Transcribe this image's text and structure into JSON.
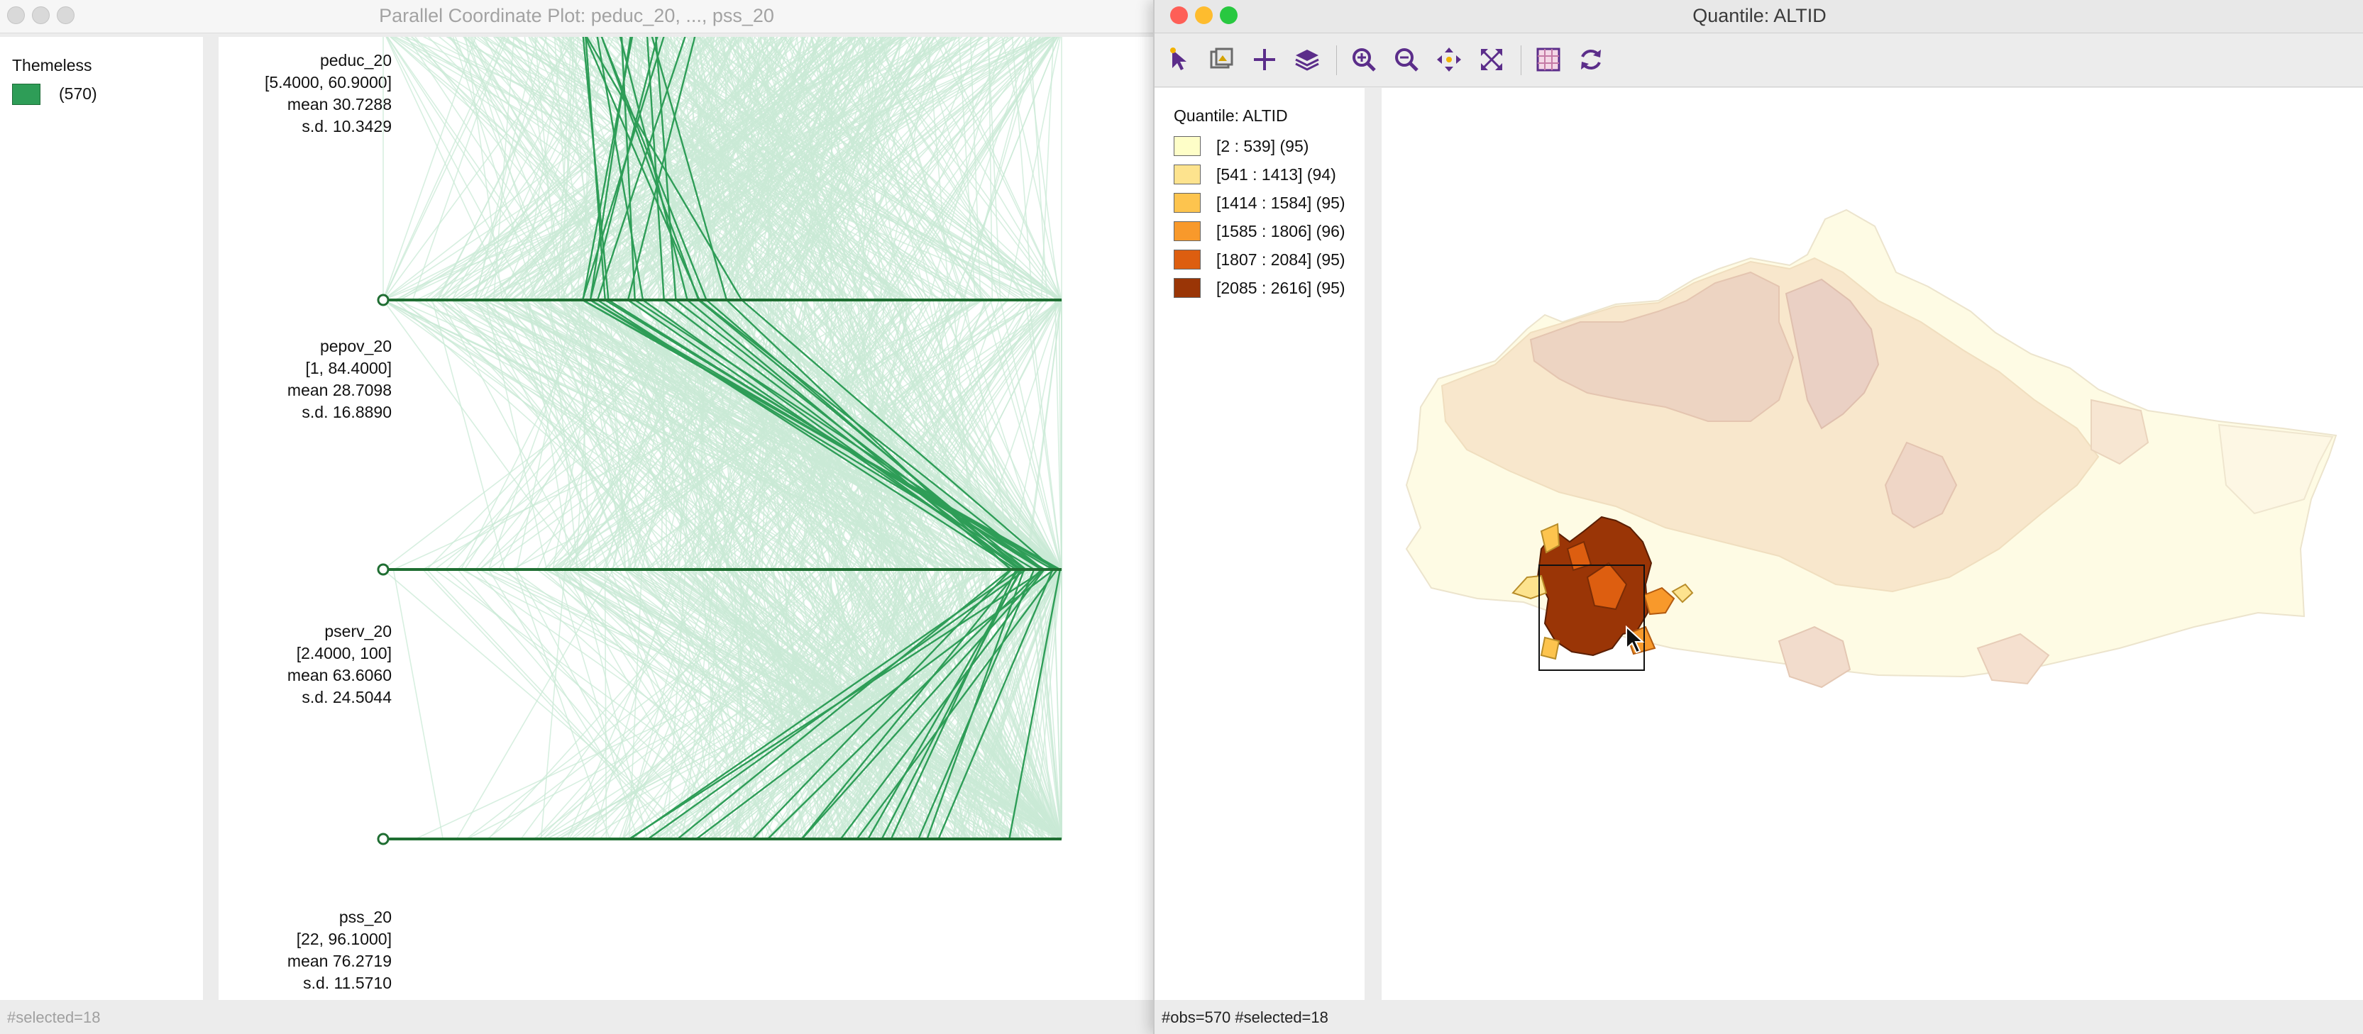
{
  "left_window": {
    "title": "Parallel Coordinate Plot: peduc_20, ..., pss_20",
    "legend": {
      "title": "Themeless",
      "items": [
        {
          "color": "#2e9d57",
          "label": "(570)"
        }
      ]
    },
    "axes": [
      {
        "name": "peduc_20",
        "range": "[5.4000, 60.9000]",
        "mean": "mean  30.7288",
        "sd": "s.d.  10.3429"
      },
      {
        "name": "pepov_20",
        "range": "[1, 84.4000]",
        "mean": "mean  28.7098",
        "sd": "s.d.  16.8890"
      },
      {
        "name": "pserv_20",
        "range": "[2.4000, 100]",
        "mean": "mean  63.6060",
        "sd": "s.d.  24.5044"
      },
      {
        "name": "pss_20",
        "range": "[22, 96.1000]",
        "mean": "mean  76.2719",
        "sd": "s.d.  11.5710"
      }
    ],
    "status": "#selected=18",
    "colors": {
      "line_faint": "#c9e9d6",
      "line_selected": "#2e9d57",
      "axis": "#1f6e32"
    }
  },
  "right_window": {
    "title": "Quantile: ALTID",
    "toolbar": [
      {
        "icon": "select-arrow-icon"
      },
      {
        "icon": "copy-map-icon"
      },
      {
        "icon": "crosshair-icon"
      },
      {
        "icon": "layers-icon"
      },
      {
        "icon": "zoom-in-icon"
      },
      {
        "icon": "zoom-out-icon"
      },
      {
        "icon": "pan-icon"
      },
      {
        "icon": "full-extent-icon"
      },
      {
        "icon": "basemap-icon"
      },
      {
        "icon": "refresh-icon"
      }
    ],
    "legend": {
      "title": "Quantile: ALTID",
      "items": [
        {
          "color": "#fefec8",
          "label": "[2 : 539] (95)"
        },
        {
          "color": "#fde38e",
          "label": "[541 : 1413] (94)"
        },
        {
          "color": "#fdc44e",
          "label": "[1414 : 1584] (95)"
        },
        {
          "color": "#f8992b",
          "label": "[1585 : 1806] (96)"
        },
        {
          "color": "#dd5e10",
          "label": "[1807 : 2084] (95)"
        },
        {
          "color": "#9a3506",
          "label": "[2085 : 2616] (95)"
        }
      ]
    },
    "status": "#obs=570 #selected=18"
  }
}
